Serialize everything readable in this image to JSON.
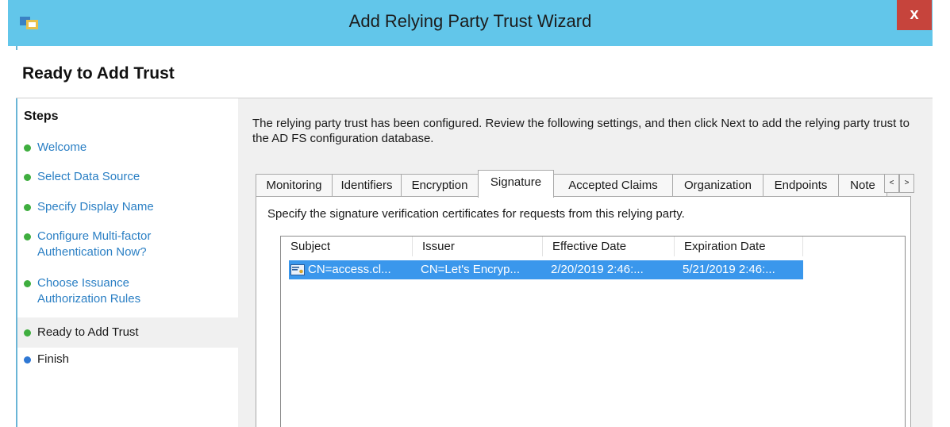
{
  "window": {
    "title": "Add Relying Party Trust Wizard",
    "close_label": "x"
  },
  "page": {
    "heading": "Ready to Add Trust"
  },
  "steps": {
    "heading": "Steps",
    "items": [
      {
        "label": "Welcome",
        "status": "done"
      },
      {
        "label": "Select Data Source",
        "status": "done"
      },
      {
        "label": "Specify Display Name",
        "status": "done"
      },
      {
        "label": "Configure Multi-factor Authentication Now?",
        "status": "done"
      },
      {
        "label": "Choose Issuance Authorization Rules",
        "status": "done"
      },
      {
        "label": "Ready to Add Trust",
        "status": "current"
      },
      {
        "label": "Finish",
        "status": "pending"
      }
    ]
  },
  "main": {
    "intro": "The relying party trust has been configured. Review the following settings, and then click Next to add the relying party trust to the AD FS configuration database.",
    "tabs": [
      "Monitoring",
      "Identifiers",
      "Encryption",
      "Signature",
      "Accepted Claims",
      "Organization",
      "Endpoints",
      "Note"
    ],
    "active_tab": "Signature",
    "scroll_left": "<",
    "scroll_right": ">",
    "signature": {
      "description": "Specify the signature verification certificates for requests from this relying party.",
      "columns": [
        "Subject",
        "Issuer",
        "Effective Date",
        "Expiration Date"
      ],
      "rows": [
        {
          "subject": "CN=access.cl...",
          "issuer": "CN=Let's Encryp...",
          "effective": "2/20/2019 2:46:...",
          "expiration": "5/21/2019 2:46:..."
        }
      ]
    }
  },
  "colors": {
    "titlebar": "#62c6ea",
    "close": "#c6443c",
    "step_done": "#3fae3f",
    "step_pending": "#2f78d4",
    "link": "#2a7fc4",
    "selection": "#3a97ec"
  }
}
